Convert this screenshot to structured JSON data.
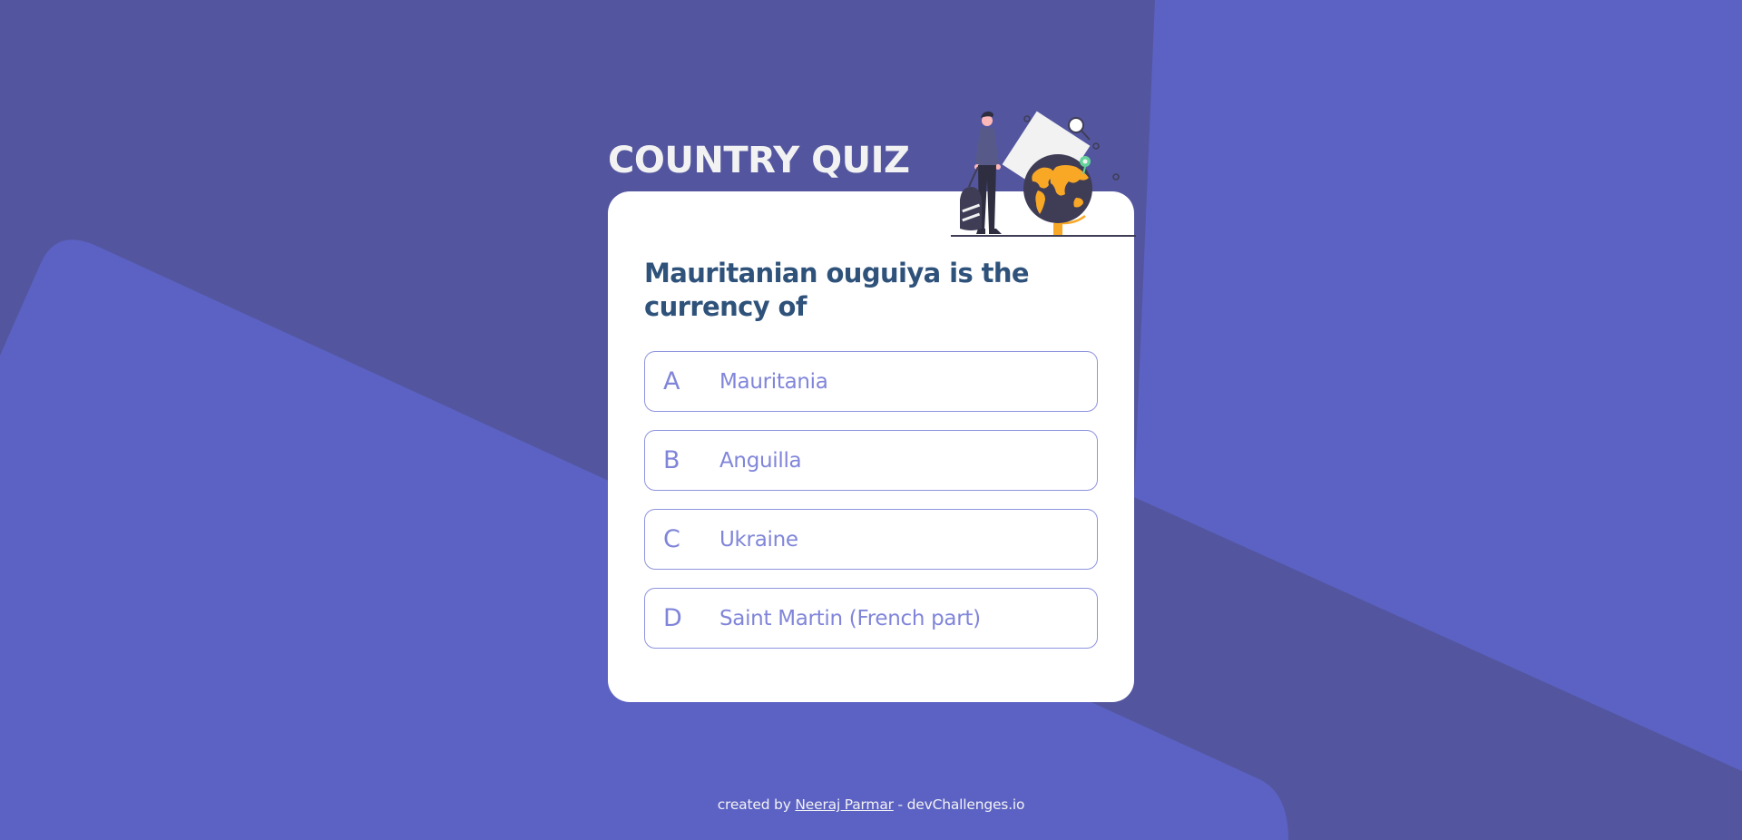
{
  "app": {
    "title": "COUNTRY QUIZ"
  },
  "colors": {
    "background_dark": "#53569f",
    "background_light": "#5c62c4",
    "card": "#ffffff",
    "question_text": "#2f527b",
    "option_accent": "#6066d0",
    "footer_text": "#f2f2f2"
  },
  "quiz": {
    "question": "Mauritanian ouguiya is the currency of",
    "options": [
      {
        "letter": "A",
        "text": "Mauritania"
      },
      {
        "letter": "B",
        "text": "Anguilla"
      },
      {
        "letter": "C",
        "text": "Ukraine"
      },
      {
        "letter": "D",
        "text": "Saint Martin (French part)"
      }
    ]
  },
  "illustration": {
    "icon": "traveler-globe-illustration"
  },
  "footer": {
    "prefix": "created by",
    "author": "Neeraj Parmar",
    "separator": "-",
    "site": "devChallenges.io"
  }
}
